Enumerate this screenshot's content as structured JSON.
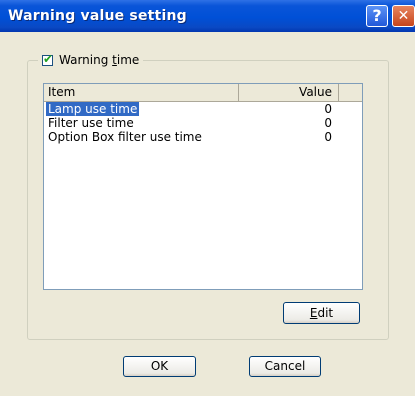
{
  "window": {
    "title": "Warning value setting",
    "help_glyph": "?",
    "close_glyph": "✕"
  },
  "group": {
    "checkbox_checked": true,
    "label_prefix": "Warning ",
    "label_accel": "t",
    "label_suffix": "ime"
  },
  "list": {
    "columns": [
      "Item",
      "Value"
    ],
    "rows": [
      {
        "item": "Lamp use time",
        "value": "0",
        "selected": true
      },
      {
        "item": "Filter use time",
        "value": "0",
        "selected": false
      },
      {
        "item": "Option Box filter use time",
        "value": "0",
        "selected": false
      }
    ]
  },
  "buttons": {
    "edit_accel": "E",
    "edit_rest": "dit",
    "ok": "OK",
    "cancel": "Cancel"
  },
  "colors": {
    "titlebar": "#0050d7",
    "selection": "#316ac5",
    "dialog_bg": "#ece9d8"
  }
}
